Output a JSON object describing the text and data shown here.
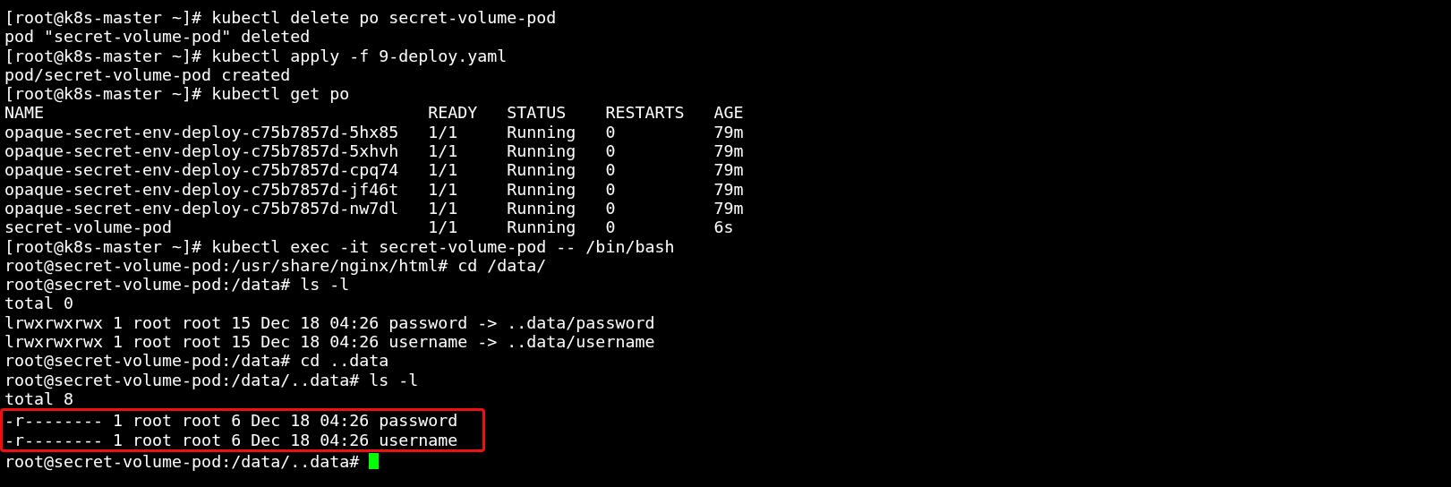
{
  "terminal": {
    "lines": [
      {
        "text": "[root@k8s-master ~]# kubectl delete po secret-volume-pod",
        "highlighted": false
      },
      {
        "text": "pod \"secret-volume-pod\" deleted",
        "highlighted": false
      },
      {
        "text": "[root@k8s-master ~]# kubectl apply -f 9-deploy.yaml",
        "highlighted": false
      },
      {
        "text": "pod/secret-volume-pod created",
        "highlighted": false
      },
      {
        "text": "[root@k8s-master ~]# kubectl get po",
        "highlighted": false
      },
      {
        "text": "NAME                                       READY   STATUS    RESTARTS   AGE",
        "highlighted": false
      },
      {
        "text": "opaque-secret-env-deploy-c75b7857d-5hx85   1/1     Running   0          79m",
        "highlighted": false
      },
      {
        "text": "opaque-secret-env-deploy-c75b7857d-5xhvh   1/1     Running   0          79m",
        "highlighted": false
      },
      {
        "text": "opaque-secret-env-deploy-c75b7857d-cpq74   1/1     Running   0          79m",
        "highlighted": false
      },
      {
        "text": "opaque-secret-env-deploy-c75b7857d-jf46t   1/1     Running   0          79m",
        "highlighted": false
      },
      {
        "text": "opaque-secret-env-deploy-c75b7857d-nw7dl   1/1     Running   0          79m",
        "highlighted": false
      },
      {
        "text": "secret-volume-pod                          1/1     Running   0          6s",
        "highlighted": false
      },
      {
        "text": "[root@k8s-master ~]# kubectl exec -it secret-volume-pod -- /bin/bash",
        "highlighted": false
      },
      {
        "text": "root@secret-volume-pod:/usr/share/nginx/html# cd /data/",
        "highlighted": false
      },
      {
        "text": "root@secret-volume-pod:/data# ls -l",
        "highlighted": false
      },
      {
        "text": "total 0",
        "highlighted": false
      },
      {
        "text": "lrwxrwxrwx 1 root root 15 Dec 18 04:26 password -> ..data/password",
        "highlighted": false
      },
      {
        "text": "lrwxrwxrwx 1 root root 15 Dec 18 04:26 username -> ..data/username",
        "highlighted": false
      },
      {
        "text": "root@secret-volume-pod:/data# cd ..data",
        "highlighted": false
      },
      {
        "text": "root@secret-volume-pod:/data/..data# ls -l",
        "highlighted": false
      },
      {
        "text": "total 8",
        "highlighted": false
      },
      {
        "text": "-r-------- 1 root root 6 Dec 18 04:26 password",
        "highlighted": true
      },
      {
        "text": "-r-------- 1 root root 6 Dec 18 04:26 username",
        "highlighted": true
      },
      {
        "text": "root@secret-volume-pod:/data/..data# ",
        "highlighted": false,
        "cursor": true
      }
    ]
  }
}
